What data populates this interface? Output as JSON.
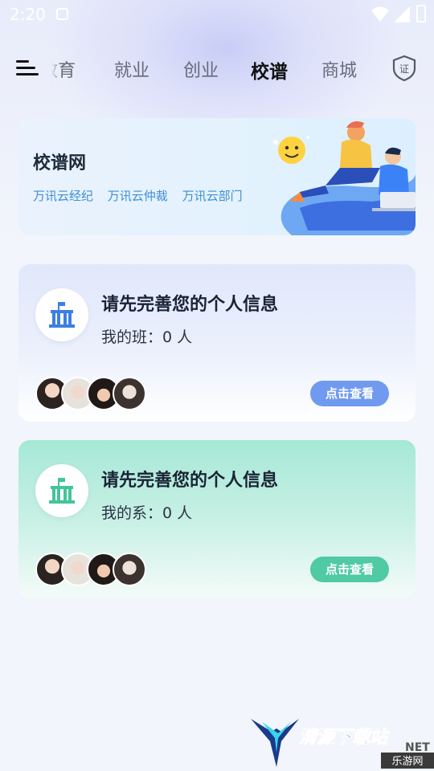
{
  "status_bar": {
    "time": "2:20"
  },
  "nav": {
    "tabs": [
      {
        "label": "教育",
        "active": false
      },
      {
        "label": "就业",
        "active": false
      },
      {
        "label": "创业",
        "active": false
      },
      {
        "label": "校谱",
        "active": true
      },
      {
        "label": "商城",
        "active": false
      }
    ],
    "cert_icon_label": "证"
  },
  "banner": {
    "title": "校谱网",
    "links": [
      "万讯云经纪",
      "万讯云仲裁",
      "万讯云部门"
    ]
  },
  "cards": [
    {
      "title": "请先完善您的个人信息",
      "subtitle": "我的班：0 人",
      "button": "点击查看",
      "accent": "#6f9af0",
      "icon_color": "#3d7fe0"
    },
    {
      "title": "请先完善您的个人信息",
      "subtitle": "我的系：0 人",
      "button": "点击查看",
      "accent": "#4fcaa3",
      "icon_color": "#44c49a"
    }
  ],
  "watermark": {
    "text_main": "清源下载站",
    "text_sub": "乐游网",
    "text_net": "NET"
  }
}
